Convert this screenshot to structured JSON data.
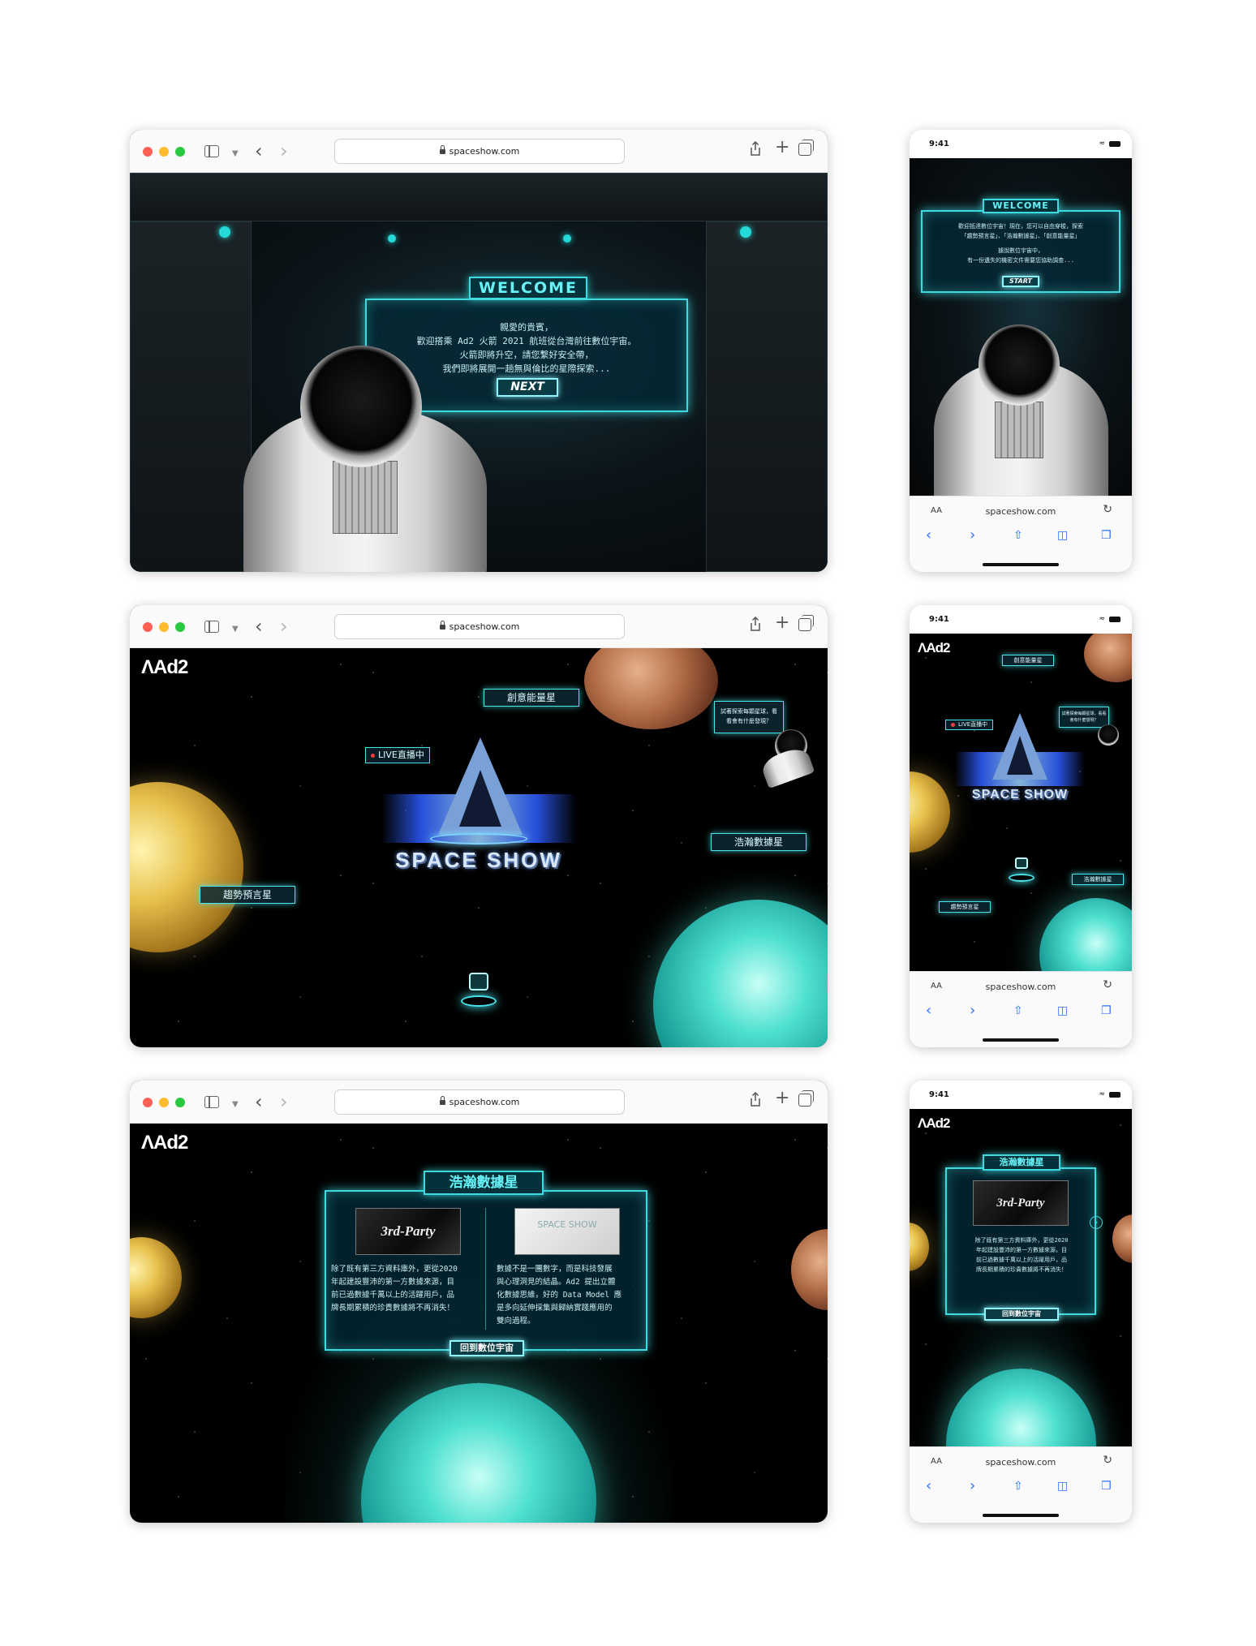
{
  "browser": {
    "url": "spaceshow.com"
  },
  "phone": {
    "time": "9:41",
    "url": "spaceshow.com",
    "aa_label": "AA"
  },
  "screen1": {
    "welcome_title": "WELCOME",
    "welcome_lines": [
      "親愛的貴賓，",
      "歡迎搭乘 Ad2 火箭 2021 航班從台灣前往數位宇宙。",
      "火箭即將升空，請您繫好安全帶，",
      "我們即將展開一趟無與倫比的星際探索..."
    ],
    "next_button": "NEXT",
    "mobile_lines": [
      "歡迎抵達數位宇宙！現在，您可以自由穿梭，探索",
      "「趨勢預言星」、「浩瀚數據星」、「創意能量星」",
      "據說數位宇宙中，",
      "有一份遺失的機密文件需要您協助調查..."
    ],
    "start_button": "START"
  },
  "screen2": {
    "logo": "Ad2",
    "planet_creative": "創意能量星",
    "planet_trend": "趨勢預言星",
    "planet_data": "浩瀚數據星",
    "live_label": "LIVE直播中",
    "speech_bubble": "試著探索每顆星球，看看會有什麼發現？",
    "show_title": "SPACE SHOW"
  },
  "screen3": {
    "logo": "Ad2",
    "panel_title": "浩瀚數據星",
    "card_left_title": "3rd-Party",
    "card_right_title": "SPACE SHOW",
    "card_left_text": [
      "除了既有第三方資料庫外，更從2020",
      "年起建設豐沛的第一方數據來源，目",
      "前已過數據千萬以上的活躍用戶，品",
      "牌長期累積的珍貴數據將不再消失！"
    ],
    "card_right_text": [
      "數據不是一團數字，而是科技發展",
      "與心理洞見的結晶。Ad2 提出立體",
      "化數據思維，好的 Data Model 應",
      "是多向延伸採集與歸納實踐應用的",
      "雙向過程。"
    ],
    "back_button": "回到數位宇宙"
  },
  "colors": {
    "neon": "#3fd9e0",
    "live_dot": "#ff3b3b",
    "ios_blue": "#2a6fff"
  }
}
